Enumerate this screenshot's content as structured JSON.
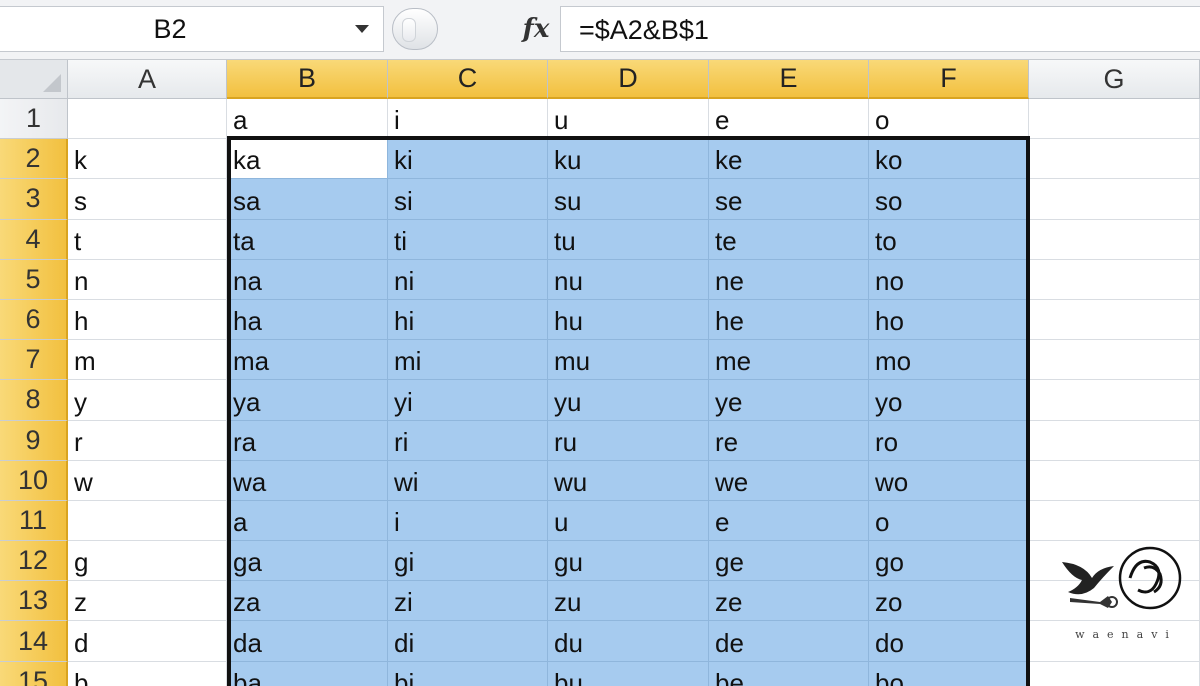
{
  "formula_bar": {
    "name_box": "B2",
    "fx_label": "fx",
    "formula": "=$A2&B$1"
  },
  "grid": {
    "columns": [
      "A",
      "B",
      "C",
      "D",
      "E",
      "F",
      "G"
    ],
    "rows": [
      {
        "num": "1",
        "cells": [
          "",
          "a",
          "i",
          "u",
          "e",
          "o",
          ""
        ]
      },
      {
        "num": "2",
        "cells": [
          "k",
          "ka",
          "ki",
          "ku",
          "ke",
          "ko",
          ""
        ]
      },
      {
        "num": "3",
        "cells": [
          "s",
          "sa",
          "si",
          "su",
          "se",
          "so",
          ""
        ]
      },
      {
        "num": "4",
        "cells": [
          "t",
          "ta",
          "ti",
          "tu",
          "te",
          "to",
          ""
        ]
      },
      {
        "num": "5",
        "cells": [
          "n",
          "na",
          "ni",
          "nu",
          "ne",
          "no",
          ""
        ]
      },
      {
        "num": "6",
        "cells": [
          "h",
          "ha",
          "hi",
          "hu",
          "he",
          "ho",
          ""
        ]
      },
      {
        "num": "7",
        "cells": [
          "m",
          "ma",
          "mi",
          "mu",
          "me",
          "mo",
          ""
        ]
      },
      {
        "num": "8",
        "cells": [
          "y",
          "ya",
          "yi",
          "yu",
          "ye",
          "yo",
          ""
        ]
      },
      {
        "num": "9",
        "cells": [
          "r",
          "ra",
          "ri",
          "ru",
          "re",
          "ro",
          ""
        ]
      },
      {
        "num": "10",
        "cells": [
          "w",
          "wa",
          "wi",
          "wu",
          "we",
          "wo",
          ""
        ]
      },
      {
        "num": "11",
        "cells": [
          "",
          "a",
          "i",
          "u",
          "e",
          "o",
          ""
        ]
      },
      {
        "num": "12",
        "cells": [
          "g",
          "ga",
          "gi",
          "gu",
          "ge",
          "go",
          ""
        ]
      },
      {
        "num": "13",
        "cells": [
          "z",
          "za",
          "zi",
          "zu",
          "ze",
          "zo",
          ""
        ]
      },
      {
        "num": "14",
        "cells": [
          "d",
          "da",
          "di",
          "du",
          "de",
          "do",
          ""
        ]
      },
      {
        "num": "15",
        "cells": [
          "b",
          "ba",
          "bi",
          "bu",
          "be",
          "bo",
          ""
        ]
      }
    ],
    "selected_columns": [
      "B",
      "C",
      "D",
      "E",
      "F"
    ],
    "active_cell": "B2",
    "selection_color": "#a6cbef",
    "header_highlight_color": "#f2c03f"
  },
  "watermark": {
    "text": "waenavi",
    "icon": "bird-key-logo"
  }
}
